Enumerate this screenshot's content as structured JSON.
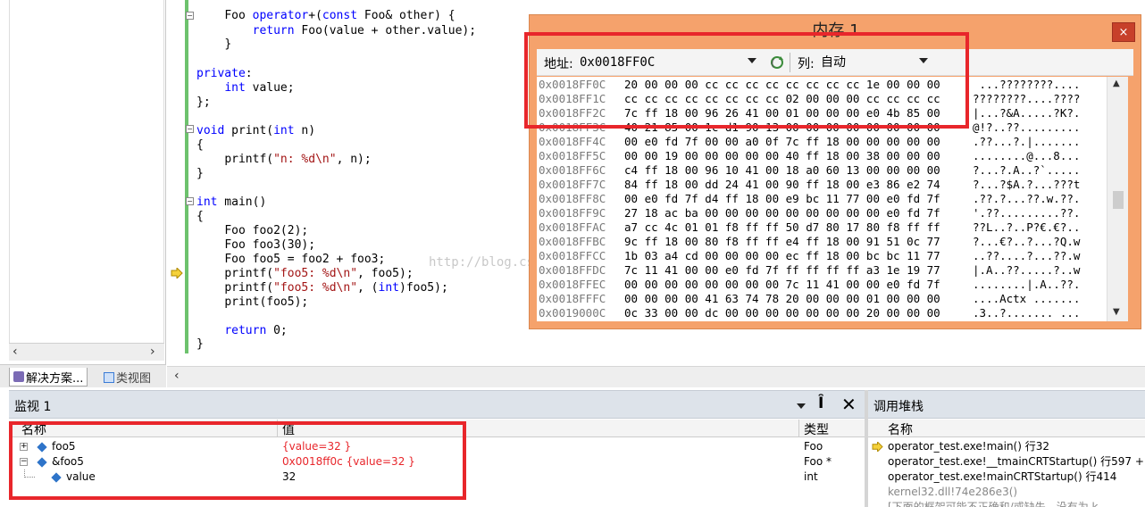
{
  "left_panel": {
    "tabs": [
      {
        "label": "解决方案..."
      },
      {
        "label": "类视图"
      }
    ]
  },
  "editor": {
    "lines": [
      {
        "indent": "    ",
        "parts": [
          [
            "Foo ",
            ""
          ],
          [
            "operator",
            "kw"
          ],
          [
            "+(",
            ""
          ],
          [
            "const",
            "kw"
          ],
          [
            " Foo& other) {",
            ""
          ]
        ]
      },
      {
        "indent": "        ",
        "parts": [
          [
            "return",
            "kw"
          ],
          [
            " Foo(value + other.value);",
            ""
          ]
        ]
      },
      {
        "indent": "    ",
        "parts": [
          [
            "}",
            ""
          ]
        ]
      },
      {
        "indent": "",
        "parts": [
          [
            "",
            ""
          ]
        ]
      },
      {
        "indent": "",
        "parts": [
          [
            "private",
            "kw"
          ],
          [
            ":",
            ""
          ]
        ]
      },
      {
        "indent": "    ",
        "parts": [
          [
            "int",
            "kw"
          ],
          [
            " value;",
            ""
          ]
        ]
      },
      {
        "indent": "",
        "parts": [
          [
            "};",
            ""
          ]
        ]
      },
      {
        "indent": "",
        "parts": [
          [
            "",
            ""
          ]
        ]
      },
      {
        "indent": "",
        "parts": [
          [
            "void",
            "kw"
          ],
          [
            " print(",
            ""
          ],
          [
            "int",
            "kw"
          ],
          [
            " n)",
            ""
          ]
        ]
      },
      {
        "indent": "",
        "parts": [
          [
            "{",
            ""
          ]
        ]
      },
      {
        "indent": "    ",
        "parts": [
          [
            "printf(",
            ""
          ],
          [
            "\"n: %d\\n\"",
            "str"
          ],
          [
            ", n);",
            ""
          ]
        ]
      },
      {
        "indent": "",
        "parts": [
          [
            "}",
            ""
          ]
        ]
      },
      {
        "indent": "",
        "parts": [
          [
            "",
            ""
          ]
        ]
      },
      {
        "indent": "",
        "parts": [
          [
            "int",
            "kw"
          ],
          [
            " main()",
            ""
          ]
        ]
      },
      {
        "indent": "",
        "parts": [
          [
            "{",
            ""
          ]
        ]
      },
      {
        "indent": "    ",
        "parts": [
          [
            "Foo foo2(2);",
            ""
          ]
        ]
      },
      {
        "indent": "    ",
        "parts": [
          [
            "Foo foo3(30);",
            ""
          ]
        ]
      },
      {
        "indent": "    ",
        "parts": [
          [
            "Foo foo5 = foo2 + foo3;",
            ""
          ]
        ]
      },
      {
        "indent": "    ",
        "parts": [
          [
            "printf(",
            ""
          ],
          [
            "\"foo5: %d\\n\"",
            "str"
          ],
          [
            ", foo5);",
            ""
          ]
        ]
      },
      {
        "indent": "    ",
        "parts": [
          [
            "printf(",
            ""
          ],
          [
            "\"foo5: %d\\n\"",
            "str"
          ],
          [
            ", (",
            ""
          ],
          [
            "int",
            "kw"
          ],
          [
            ")foo5);",
            ""
          ]
        ]
      },
      {
        "indent": "    ",
        "parts": [
          [
            "print(foo5);",
            ""
          ]
        ]
      },
      {
        "indent": "",
        "parts": [
          [
            "",
            ""
          ]
        ]
      },
      {
        "indent": "    ",
        "parts": [
          [
            "return",
            "kw"
          ],
          [
            " 0;",
            ""
          ]
        ]
      },
      {
        "indent": "",
        "parts": [
          [
            "}",
            ""
          ]
        ]
      }
    ],
    "watermark": "http://blog.csdn.net/a..."
  },
  "memory": {
    "title": "内存 1",
    "close_label": "×",
    "address_label": "地址:",
    "address_value": "0x0018FF0C",
    "columns_label": "列:",
    "columns_value": "自动",
    "rows": [
      {
        "addr": "0x0018FF0C",
        "hex": "20 00 00 00 cc cc cc cc cc cc cc cc 1e 00 00 00",
        "ascii": " ...????????...."
      },
      {
        "addr": "0x0018FF1C",
        "hex": "cc cc cc cc cc cc cc cc 02 00 00 00 cc cc cc cc",
        "ascii": "????????....????"
      },
      {
        "addr": "0x0018FF2C",
        "hex": "7c ff 18 00 96 26 41 00 01 00 00 00 e0 4b 85 00",
        "ascii": "|...?&A.....?K?."
      },
      {
        "addr": "0x0018FF3C",
        "hex": "40 21 85 00 1c d1 90 13 00 00 00 00 00 00 00 00",
        "ascii": "@!?..??........."
      },
      {
        "addr": "0x0018FF4C",
        "hex": "00 e0 fd 7f 00 00 a0 0f 7c ff 18 00 00 00 00 00",
        "ascii": ".??...?.|......."
      },
      {
        "addr": "0x0018FF5C",
        "hex": "00 00 19 00 00 00 00 00 40 ff 18 00 38 00 00 00",
        "ascii": "........@...8..."
      },
      {
        "addr": "0x0018FF6C",
        "hex": "c4 ff 18 00 96 10 41 00 18 a0 60 13 00 00 00 00",
        "ascii": "?...?.A..?`....."
      },
      {
        "addr": "0x0018FF7C",
        "hex": "84 ff 18 00 dd 24 41 00 90 ff 18 00 e3 86 e2 74",
        "ascii": "?...?$A.?...???t"
      },
      {
        "addr": "0x0018FF8C",
        "hex": "00 e0 fd 7f d4 ff 18 00 e9 bc 11 77 00 e0 fd 7f",
        "ascii": ".??.?...??.w.??."
      },
      {
        "addr": "0x0018FF9C",
        "hex": "27 18 ac ba 00 00 00 00 00 00 00 00 00 e0 fd 7f",
        "ascii": "'.??.........??."
      },
      {
        "addr": "0x0018FFAC",
        "hex": "a7 cc 4c 01 01 f8 ff ff 50 d7 80 17 80 f8 ff ff",
        "ascii": "??L..?..P?€.€?.."
      },
      {
        "addr": "0x0018FFBC",
        "hex": "9c ff 18 00 80 f8 ff ff e4 ff 18 00 91 51 0c 77",
        "ascii": "?...€?..?...?Q.w"
      },
      {
        "addr": "0x0018FFCC",
        "hex": "1b 03 a4 cd 00 00 00 00 ec ff 18 00 bc bc 11 77",
        "ascii": "..??....?...??.w"
      },
      {
        "addr": "0x0018FFDC",
        "hex": "7c 11 41 00 00 e0 fd 7f ff ff ff ff a3 1e 19 77",
        "ascii": "|.A..??.....?..w"
      },
      {
        "addr": "0x0018FFEC",
        "hex": "00 00 00 00 00 00 00 00 7c 11 41 00 00 e0 fd 7f",
        "ascii": "........|.A..??."
      },
      {
        "addr": "0x0018FFFC",
        "hex": "00 00 00 00 41 63 74 78 20 00 00 00 01 00 00 00",
        "ascii": "....Actx ......."
      },
      {
        "addr": "0x0019000C",
        "hex": "0c 33 00 00 dc 00 00 00 00 00 00 00 20 00 00 00",
        "ascii": ".3..?....... ..."
      }
    ]
  },
  "watch": {
    "title": "监视 1",
    "pin_label": "⊣",
    "close_label": "✕",
    "headers": {
      "name": "名称",
      "value": "值",
      "type": "类型"
    },
    "rows": [
      {
        "expander": "+",
        "name": "foo5",
        "value": "{value=32 }",
        "type": "Foo",
        "value_changed": true
      },
      {
        "expander": "−",
        "name": "&foo5",
        "value": "0x0018ff0c {value=32 }",
        "type": "Foo *",
        "value_changed": true
      },
      {
        "expander": "",
        "name": "value",
        "value": "32",
        "type": "int",
        "value_changed": false
      }
    ]
  },
  "callstack": {
    "title": "调用堆栈",
    "header_name": "名称",
    "rows": [
      {
        "text": "operator_test.exe!main()  行32",
        "current": true,
        "dim": false
      },
      {
        "text": "operator_test.exe!__tmainCRTStartup()  行597 +",
        "current": false,
        "dim": false
      },
      {
        "text": "operator_test.exe!mainCRTStartup()  行414",
        "current": false,
        "dim": false
      },
      {
        "text": "kernel32.dll!74e286e3()",
        "current": false,
        "dim": true
      },
      {
        "text": "[下面的框架可能不正确和/或缺失，没有为 k",
        "current": false,
        "dim": true
      }
    ]
  },
  "colors": {
    "highlight_red": "#e8262b",
    "memory_frame": "#f5a26c",
    "keyword_blue": "#0000ff",
    "string_red": "#a31515"
  }
}
